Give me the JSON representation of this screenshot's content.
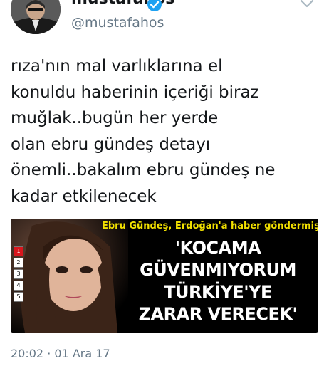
{
  "author": {
    "display_name": "mustafahos",
    "handle": "@mustafahos",
    "verified": true,
    "avatar_icon": "profile-photo",
    "verified_icon": "verified-badge-icon",
    "menu_icon": "chevron-down-icon"
  },
  "tweet": {
    "lines": [
      "rıza'nın mal varlıklarına el",
      "konuldu haberinin içeriği biraz",
      "muğlak..bugün her yerde",
      "olan ebru gündeş detayı",
      "önemli..bakalım ebru gündeş ne",
      "kadar etkilenecek"
    ],
    "timestamp": "20:02 · 01 Ara 17"
  },
  "media": {
    "subtitle": "Ebru Gündeş, Erdoğan'a haber göndermiş",
    "headline_lines": [
      "'KOCAMA",
      "GÜVENMIYORUM",
      "TÜRKİYE'YE",
      "ZARAR VERECEK'"
    ],
    "slide_numbers": [
      "1",
      "2",
      "3",
      "4",
      "5"
    ],
    "active_slide": 1
  },
  "colors": {
    "text": "#14171a",
    "secondary_text": "#657786",
    "verified_blue": "#1da1f2",
    "subtitle_yellow": "#f2e100",
    "media_background": "#000000",
    "active_slide_red": "#d8161d"
  }
}
